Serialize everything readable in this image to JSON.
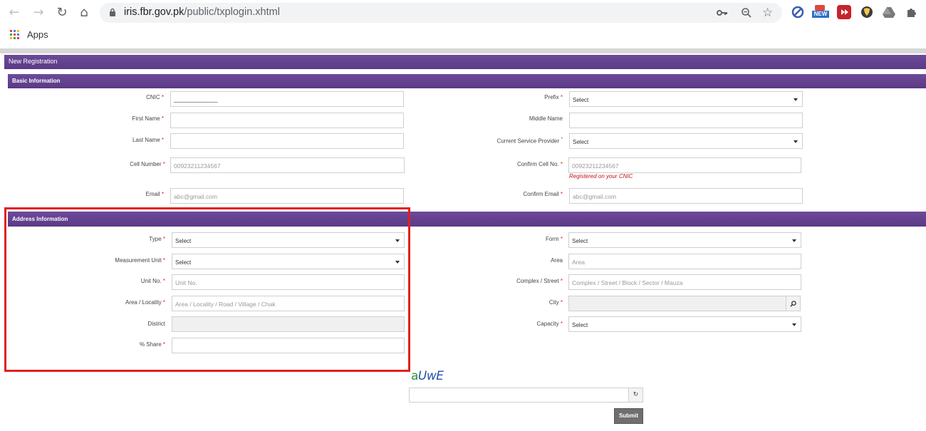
{
  "browser": {
    "url_domain": "iris.fbr.gov.pk",
    "url_path": "/public/txplogin.xhtml",
    "bookmarks_label": "Apps",
    "new_badge": "NEW",
    "icons": {
      "back": "arrow-left-icon",
      "forward": "arrow-right-icon",
      "reload": "reload-icon",
      "home": "home-icon",
      "lock": "lock-icon",
      "key": "key-icon",
      "zoom": "zoom-out-icon",
      "star": "star-icon",
      "extensions": "puzzle-icon"
    }
  },
  "page": {
    "title": "New Registration",
    "basic_section": "Basic Information",
    "address_section": "Address Information",
    "submit_label": "Submit",
    "captcha_text": "aUwE",
    "colors": {
      "bar": "#5b3a86",
      "required": "#d9261c",
      "highlight": "#e1211c"
    }
  },
  "basic": {
    "cnic": {
      "label": "CNIC",
      "value": "_____________"
    },
    "prefix": {
      "label": "Prefix",
      "value": "Select"
    },
    "first_name": {
      "label": "First Name",
      "value": ""
    },
    "middle_name": {
      "label": "Middle Name",
      "value": ""
    },
    "last_name": {
      "label": "Last Name",
      "value": ""
    },
    "service_provider": {
      "label": "Current Service Provider",
      "value": "Select"
    },
    "cell": {
      "label": "Cell Number",
      "placeholder": "00923211234567"
    },
    "confirm_cell": {
      "label": "Confirm Cell No.",
      "placeholder": "00923211234567",
      "note": "Registered on your CNIC"
    },
    "email": {
      "label": "Email",
      "placeholder": "abc@gmail.com"
    },
    "confirm_email": {
      "label": "Confirm Email",
      "placeholder": "abc@gmail.com"
    }
  },
  "address": {
    "type": {
      "label": "Type",
      "value": "Select"
    },
    "form": {
      "label": "Form",
      "value": "Select"
    },
    "measurement_unit": {
      "label": "Measurement Unit",
      "value": "Select"
    },
    "area": {
      "label": "Area",
      "placeholder": "Area"
    },
    "unit_no": {
      "label": "Unit No.",
      "placeholder": "Unit No."
    },
    "complex_street": {
      "label": "Complex / Street",
      "placeholder": "Complex / Street / Block / Sector / Mauza"
    },
    "area_locality": {
      "label": "Area / Locality",
      "placeholder": "Area / Locality / Road / Village / Chak"
    },
    "city": {
      "label": "City",
      "value": ""
    },
    "district": {
      "label": "District",
      "value": ""
    },
    "capacity": {
      "label": "Capacity",
      "value": "Select"
    },
    "share": {
      "label": "% Share",
      "value": ""
    }
  },
  "required_mark": "*"
}
